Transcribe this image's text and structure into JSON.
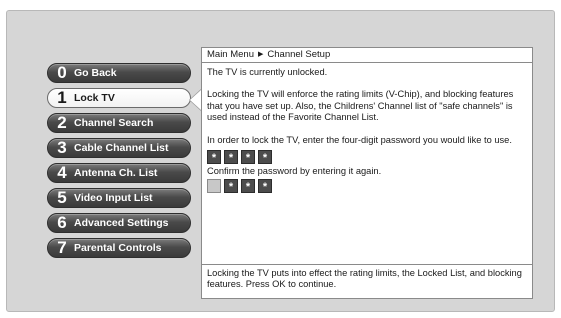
{
  "menu": {
    "items": [
      {
        "num": "0",
        "label": "Go Back"
      },
      {
        "num": "1",
        "label": "Lock TV"
      },
      {
        "num": "2",
        "label": "Channel Search"
      },
      {
        "num": "3",
        "label": "Cable Channel List"
      },
      {
        "num": "4",
        "label": "Antenna Ch. List"
      },
      {
        "num": "5",
        "label": "Video Input List"
      },
      {
        "num": "6",
        "label": "Advanced Settings"
      },
      {
        "num": "7",
        "label": "Parental Controls"
      }
    ],
    "selected_index": 1
  },
  "breadcrumb": {
    "root": "Main Menu",
    "arrow": "▶",
    "current": "Channel Setup"
  },
  "content": {
    "status": "The TV is currently unlocked.",
    "description": "Locking the TV will enforce the rating limits (V-Chip), and blocking features that you have set up. Also, the Childrens' Channel list of \"safe channels\" is used instead of the Favorite Channel List.",
    "instruction": "In order to lock the TV, enter the four-digit password you would like to use.",
    "password_mask": [
      "*",
      "*",
      "*",
      "*"
    ],
    "confirm_label": "Confirm the password by entering it again.",
    "confirm_mask": [
      "",
      "*",
      "*",
      "*"
    ]
  },
  "footer": {
    "text": "Locking the TV puts into effect the rating limits, the Locked List, and blocking features. Press OK to continue."
  }
}
